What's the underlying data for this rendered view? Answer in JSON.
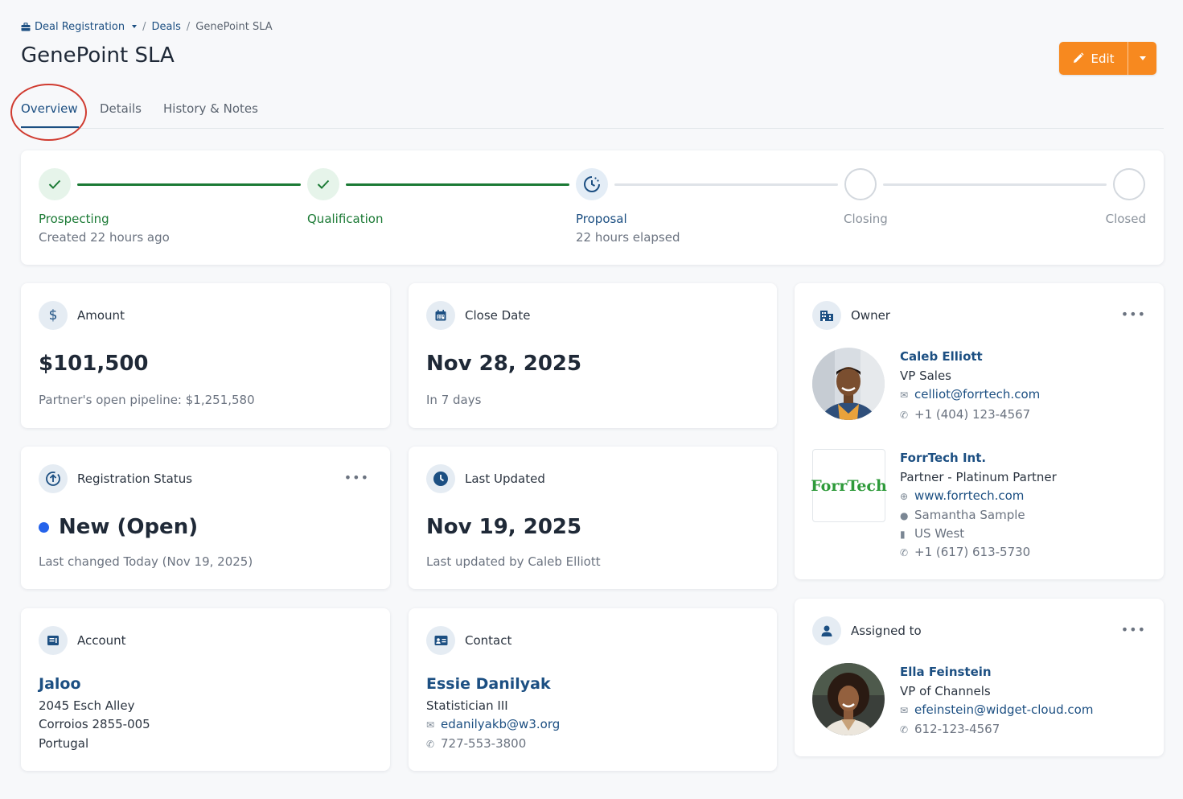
{
  "breadcrumb": {
    "root": "Deal Registration",
    "deals": "Deals",
    "current": "GenePoint SLA"
  },
  "page": {
    "title": "GenePoint SLA"
  },
  "actions": {
    "edit_label": "Edit"
  },
  "tabs": [
    "Overview",
    "Details",
    "History & Notes"
  ],
  "stages": [
    {
      "label": "Prospecting",
      "sub": "Created 22 hours ago",
      "state": "done"
    },
    {
      "label": "Qualification",
      "sub": "",
      "state": "done"
    },
    {
      "label": "Proposal",
      "sub": "22 hours elapsed",
      "state": "current"
    },
    {
      "label": "Closing",
      "sub": "",
      "state": "todo"
    },
    {
      "label": "Closed",
      "sub": "",
      "state": "todo"
    }
  ],
  "amount": {
    "title": "Amount",
    "value": "$101,500",
    "sub": "Partner's open pipeline: $1,251,580"
  },
  "close_date": {
    "title": "Close Date",
    "value": "Nov 28, 2025",
    "sub": "In 7 days"
  },
  "registration": {
    "title": "Registration Status",
    "value": "New (Open)",
    "sub": "Last changed Today (Nov 19, 2025)",
    "status_color": "#2563eb"
  },
  "last_updated": {
    "title": "Last Updated",
    "value": "Nov 19, 2025",
    "sub": "Last updated by Caleb Elliott"
  },
  "account": {
    "title": "Account",
    "name": "Jaloo",
    "address1": "2045 Esch Alley",
    "address2": "Corroios 2855-005",
    "country": "Portugal"
  },
  "contact": {
    "title": "Contact",
    "name": "Essie Danilyak",
    "role": "Statistician III",
    "email": "edanilyakb@w3.org",
    "phone": "727-553-3800"
  },
  "owner": {
    "title": "Owner",
    "person": {
      "name": "Caleb Elliott",
      "role": "VP Sales",
      "email": "celliot@forrtech.com",
      "phone": "+1 (404) 123-4567"
    },
    "company": {
      "name": "ForrTech Int.",
      "tier": "Partner - Platinum Partner",
      "website": "www.forrtech.com",
      "contact": "Samantha Sample",
      "region": "US West",
      "phone": "+1 (617) 613-5730",
      "logo_text": "ForrTech"
    }
  },
  "assigned": {
    "title": "Assigned to",
    "name": "Ella Feinstein",
    "role": "VP of Channels",
    "email": "efeinstein@widget-cloud.com",
    "phone": "612-123-4567"
  },
  "colors": {
    "accent": "#f7891f",
    "brand": "#1c4f82",
    "success": "#1b7a35",
    "annotation": "#d03b30"
  }
}
